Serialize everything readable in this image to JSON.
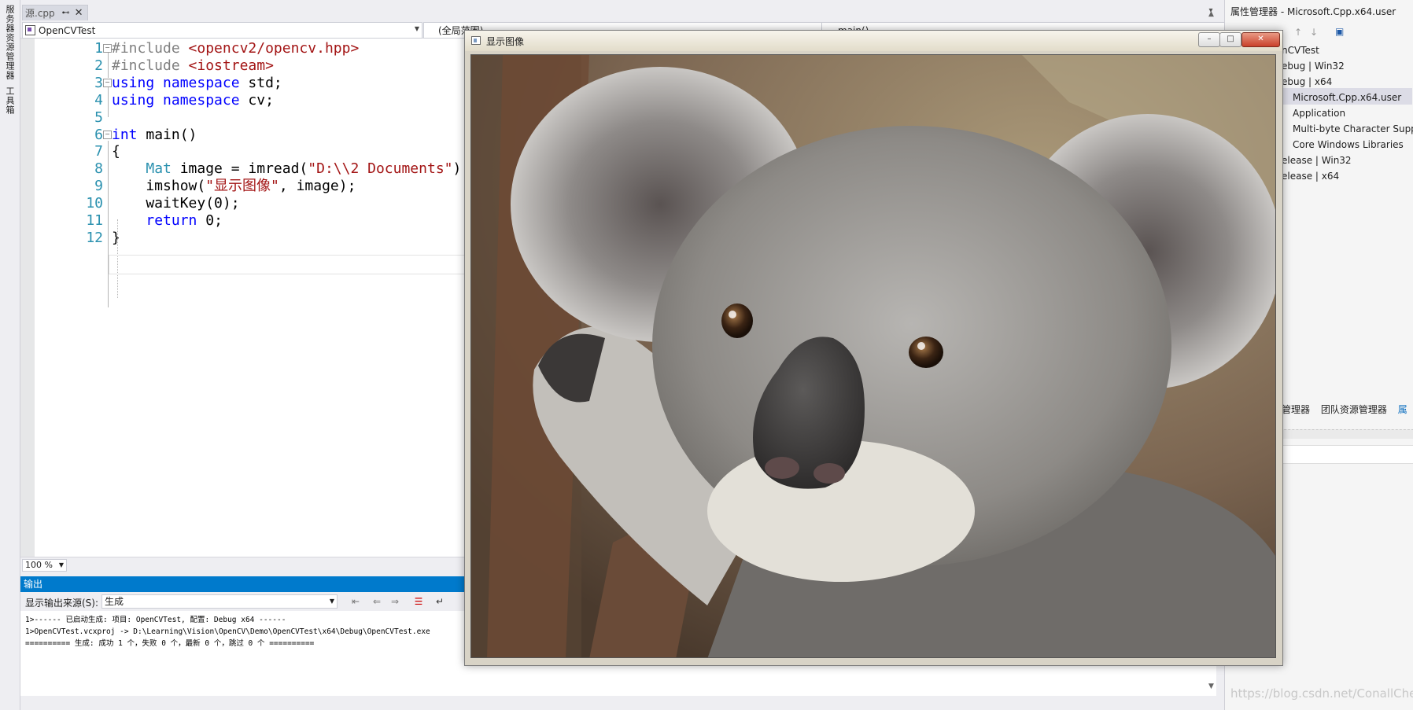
{
  "left_strip": {
    "tabs": [
      "服务器资源管理器",
      "工具箱"
    ]
  },
  "editor_tabs": [
    {
      "label": "源.cpp",
      "pin": "⊷",
      "close": "✕"
    }
  ],
  "nav": {
    "project": "OpenCVTest",
    "scope": "(全局范围)",
    "member": "main()"
  },
  "code_lines": [
    {
      "n": "1",
      "text": "#include <opencv2/opencv.hpp>"
    },
    {
      "n": "2",
      "text": "#include <iostream>"
    },
    {
      "n": "3",
      "text": "using namespace std;"
    },
    {
      "n": "4",
      "text": "using namespace cv;"
    },
    {
      "n": "5",
      "text": ""
    },
    {
      "n": "6",
      "text": "int main()"
    },
    {
      "n": "7",
      "text": "{"
    },
    {
      "n": "8",
      "text": "    Mat image = imread(\"D:\\\\2 Documents\");"
    },
    {
      "n": "9",
      "text": "    imshow(\"显示图像\", image);"
    },
    {
      "n": "10",
      "text": "    waitKey(0);"
    },
    {
      "n": "11",
      "text": "    return 0;"
    },
    {
      "n": "12",
      "text": "}"
    }
  ],
  "zoom": {
    "value": "100 %"
  },
  "output": {
    "title": "输出",
    "source_label": "显示输出来源(S):",
    "source_value": "生成",
    "lines": [
      "1>------ 已启动生成: 项目: OpenCVTest, 配置: Debug x64 ------",
      "1>OpenCVTest.vcxproj -> D:\\Learning\\Vision\\OpenCV\\Demo\\OpenCVTest\\x64\\Debug\\OpenCVTest.exe",
      "========== 生成: 成功 1 个，失败 0 个，最新 0 个，跳过 0 个 =========="
    ]
  },
  "property_manager": {
    "title": "属性管理器 - Microsoft.Cpp.x64.user",
    "items": [
      "nCVTest",
      "ebug | Win32",
      "ebug | x64",
      "Microsoft.Cpp.x64.user",
      "Application",
      "Multi-byte Character Support",
      "Core Windows Libraries",
      "elease | Win32",
      "elease | x64"
    ],
    "bottom_tabs": [
      "源管理器",
      "团队资源管理器",
      "属"
    ]
  },
  "image_window": {
    "title": "显示图像",
    "buttons": {
      "minimize": "–",
      "maximize": "□",
      "close": "✕"
    },
    "image_subject": "koala photograph"
  },
  "watermark": "https://blog.csdn.net/ConallChen",
  "colors": {
    "accent": "#007acc",
    "keyword": "#0000ff",
    "string": "#a31515",
    "type": "#2b91af",
    "line_number": "#2b91af"
  }
}
